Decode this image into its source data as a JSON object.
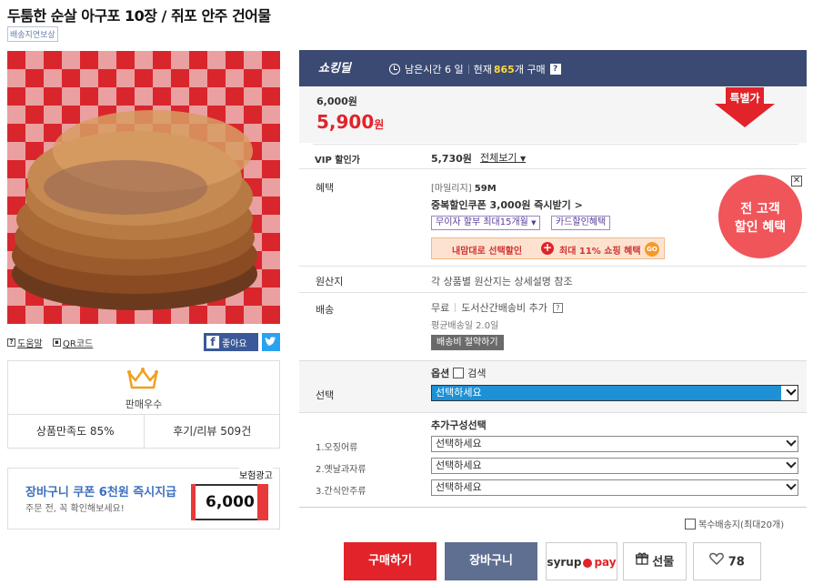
{
  "product": {
    "title": "두툼한 순살 아구포 10장 / 쥐포 안주 건어물",
    "tag": "배송지연보상"
  },
  "photo": {
    "icon": "dried-fish-photo"
  },
  "utils": {
    "help_label": "도움말",
    "qr_label": "QR코드",
    "like_label": "좋아요"
  },
  "seller": {
    "grade": "판매우수",
    "satisfaction": "상품만족도 85%",
    "reviews": "후기/리뷰 509건"
  },
  "ad": {
    "label": "보험광고",
    "title": "장바구니 쿠폰 6천원 즉시지급",
    "subtitle": "주문 전, 꼭 확인해보세요!",
    "coupon_amount": "6,000"
  },
  "deal": {
    "logo": "쇼킹딜",
    "time_left": "남은시간 6 일",
    "current_prefix": "현재",
    "current_count": "865",
    "current_suffix": "개 구매",
    "help": "?"
  },
  "price": {
    "original": "6,000원",
    "sale": "5,900",
    "sale_unit": "원",
    "special_badge": "특별가"
  },
  "vip": {
    "label": "VIP 할인가",
    "price": "5,730원",
    "view_all": "전체보기"
  },
  "benefit": {
    "label": "혜택",
    "mileage_prefix": "[마일리지]",
    "mileage_value": "59M",
    "coupon": "중복할인쿠폰 3,000원 즉시받기 >",
    "chip_installment": "무이자 할부 최대15개월",
    "chip_card": "카드할인혜택",
    "promo_left": "내맘대로 선택할인",
    "promo_right": "최대 11% 쇼핑 혜택",
    "promo_go": "GO",
    "circle_line1": "전 고객",
    "circle_line2": "할인 혜택"
  },
  "origin": {
    "label": "원산지",
    "value": "각 상품별 원산지는 상세설명 참조"
  },
  "shipping": {
    "label": "배송",
    "free": "무료",
    "extra": "도서산간배송비 추가",
    "average": "평균배송일 2.0일",
    "save_button": "배송비 절약하기"
  },
  "option": {
    "label": "선택",
    "header": "옵션",
    "search": "검색",
    "select_placeholder": "선택하세요"
  },
  "addons": {
    "header": "추가구성선택",
    "items": [
      {
        "label": "1.오징어류",
        "value": "선택하세요"
      },
      {
        "label": "2.옛날과자류",
        "value": "선택하세요"
      },
      {
        "label": "3.간식안주류",
        "value": "선택하세요"
      }
    ]
  },
  "multi_ship": "복수배송지(최대20개)",
  "actions": {
    "buy": "구매하기",
    "cart": "장바구니",
    "syrup": "syrup",
    "pay": "pay",
    "gift": "선물",
    "likes": "78"
  },
  "colors": {
    "accent_red": "#e2232a",
    "deal_bar": "#3b4a72",
    "highlight_yellow": "#ffd83a",
    "select_blue": "#1e90d6"
  }
}
